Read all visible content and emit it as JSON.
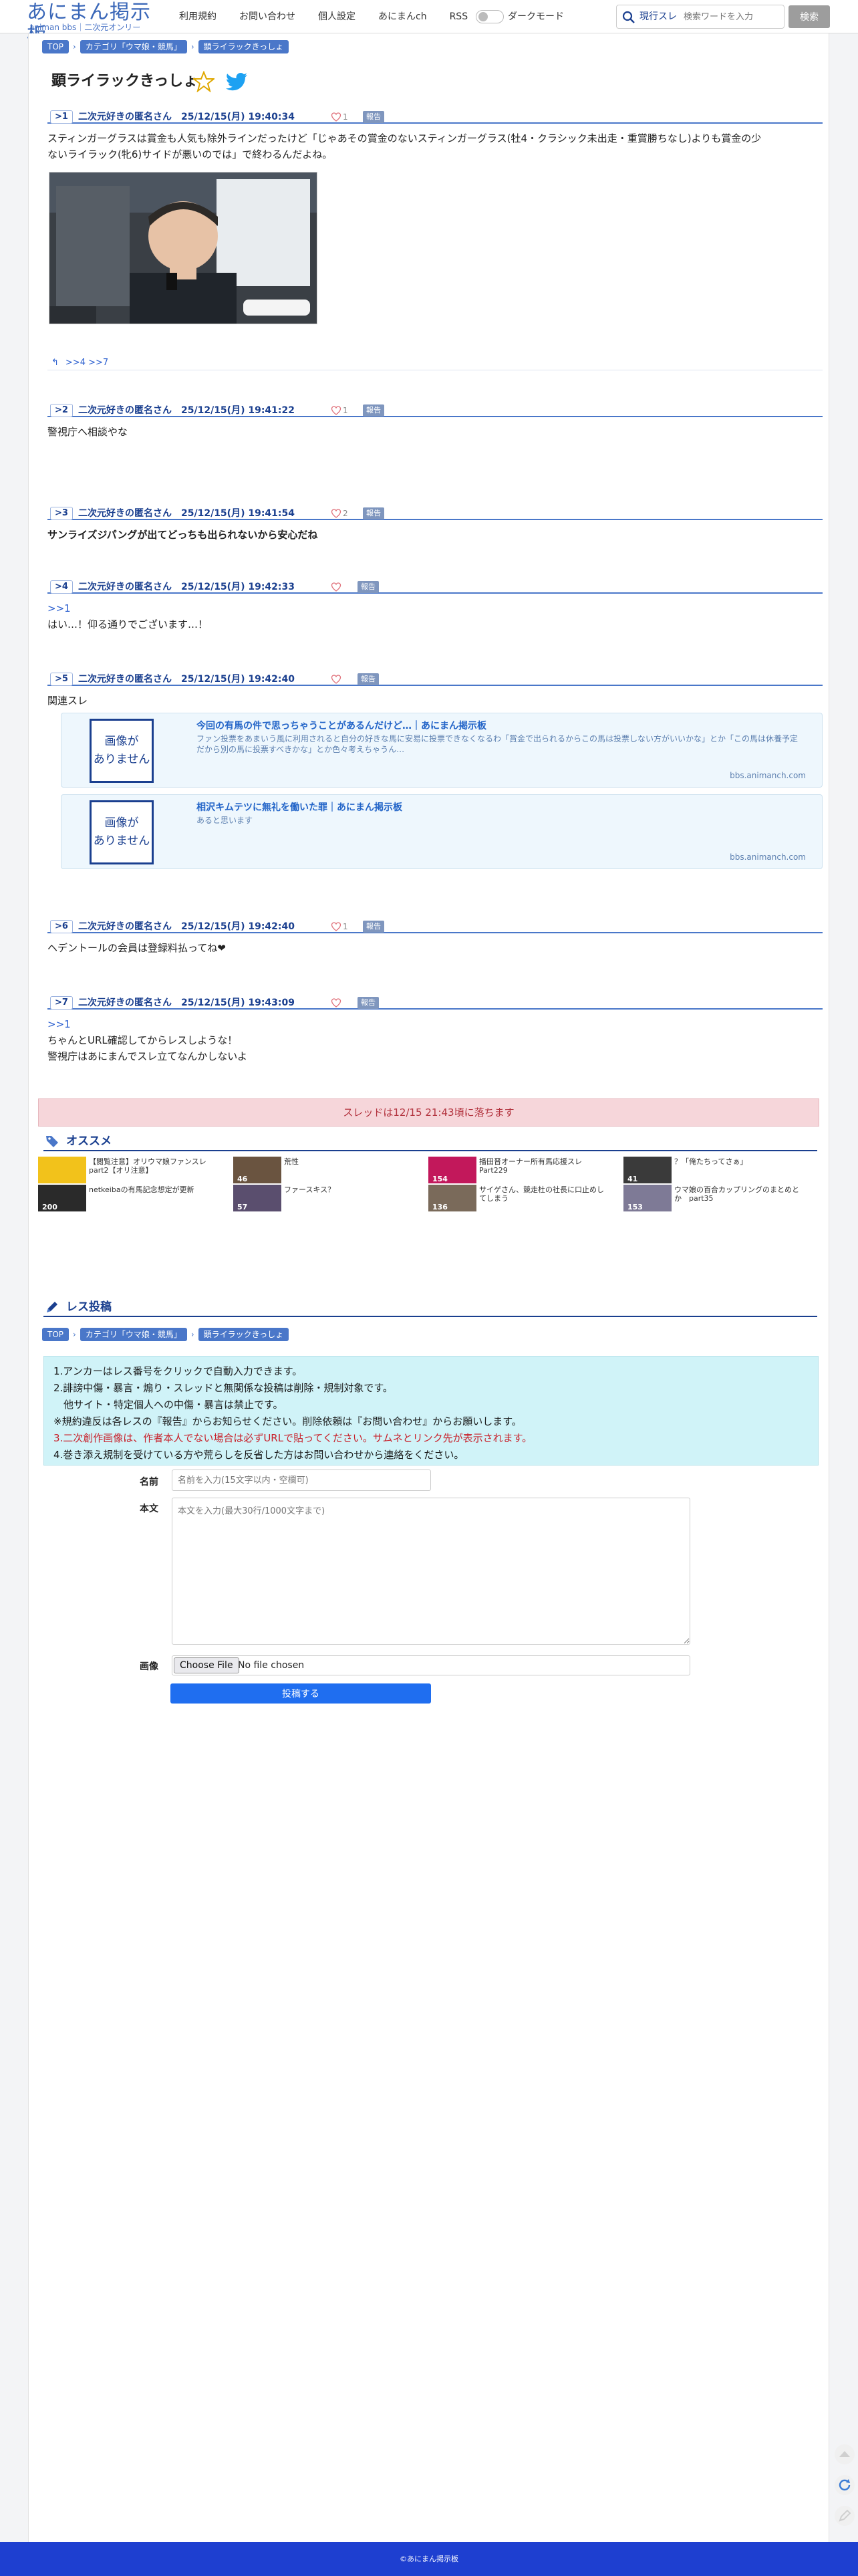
{
  "header": {
    "logo_main": "あにまん掲示板",
    "logo_sub": "animan bbs｜二次元オンリー",
    "menu": [
      "利用規約",
      "お問い合わせ",
      "個人設定",
      "あにまんch",
      "RSS"
    ],
    "dark_mode_label": "ダークモード",
    "search_scope": "現行スレ",
    "search_placeholder": "検索ワードを入力",
    "search_button": "検索"
  },
  "breadcrumb": [
    "TOP",
    "カテゴリ「ウマ娘・競馬」",
    "顕ライラックきっしょ"
  ],
  "thread": {
    "title": "顕ライラックきっしょ"
  },
  "posts": [
    {
      "num": "1",
      "meta": "二次元好きの匿名さん　25/12/15(月) 19:40:34",
      "likes": "1",
      "report": "報告",
      "lines": [
        "スティンガーグラスは賞金も人気も除外ラインだったけど「じゃあその賞金のないスティンガーグラス(牡4・クラシック未出走・重賞勝ちなし)よりも賞金の少",
        "ないライラック(牝6)サイドが悪いのでは」で終わるんだよね。"
      ],
      "replies": ">>4 >>7"
    },
    {
      "num": "2",
      "meta": "二次元好きの匿名さん　25/12/15(月) 19:41:22",
      "likes": "1",
      "report": "報告",
      "lines": [
        "警視庁へ相談やな"
      ]
    },
    {
      "num": "3",
      "meta": "二次元好きの匿名さん　25/12/15(月) 19:41:54",
      "likes": "2",
      "report": "報告",
      "lines": [
        "サンライズジパングが出てどっちも出られないから安心だね"
      ]
    },
    {
      "num": "4",
      "meta": "二次元好きの匿名さん　25/12/15(月) 19:42:33",
      "likes": "",
      "report": "報告",
      "anchor": ">>1",
      "lines": [
        "はい…！仰る通りでございます…！"
      ]
    },
    {
      "num": "5",
      "meta": "二次元好きの匿名さん　25/12/15(月) 19:42:40",
      "likes": "",
      "report": "報告",
      "lines": [
        "関連スレ"
      ],
      "cards": [
        {
          "noimg_1": "画像が",
          "noimg_2": "ありません",
          "title": "今回の有馬の件で思っちゃうことがあるんだけど…｜あにまん掲示板",
          "desc": "ファン投票をあまいう風に利用されると自分の好きな馬に安易に投票できなくなるわ「賞金で出られるからこの馬は投票しない方がいいかな」とか「この馬は休養予定だから別の馬に投票すべきかな」とか色々考えちゃうん…",
          "url": "bbs.animanch.com"
        },
        {
          "noimg_1": "画像が",
          "noimg_2": "ありません",
          "title": "相沢キムテツに無礼を働いた罪｜あにまん掲示板",
          "desc": "あると思います",
          "url": "bbs.animanch.com"
        }
      ]
    },
    {
      "num": "6",
      "meta": "二次元好きの匿名さん　25/12/15(月) 19:42:40",
      "likes": "1",
      "report": "報告",
      "lines": [
        "ヘデントールの会員は登録料払ってね❤"
      ]
    },
    {
      "num": "7",
      "meta": "二次元好きの匿名さん　25/12/15(月) 19:43:09",
      "likes": "",
      "report": "報告",
      "anchor": ">>1",
      "lines": [
        "ちゃんとURL確認してからレスしような！",
        "警視庁はあにまんでスレ立てなんかしないよ"
      ]
    }
  ],
  "drop_notice": "スレッドは12/15 21:43頃に落ちます",
  "recommend": {
    "heading": "オススメ",
    "items": [
      {
        "title": "【閲覧注意】オリウマ娘ファンスレ part2【オリ注意】",
        "count": "",
        "color": "#f2c21b"
      },
      {
        "title": "荒性",
        "count": "46",
        "color": "#6a5440"
      },
      {
        "title": "播田晋オーナー所有馬応援スレPart229",
        "count": "154",
        "color": "#c2185b"
      },
      {
        "title": "？「俺たちってさぁ」",
        "count": "41",
        "color": "#3a3a3a"
      },
      {
        "title": "netkeibaの有馬記念想定が更新",
        "count": "200",
        "color": "#2a2a2a"
      },
      {
        "title": "ファースキス？",
        "count": "57",
        "color": "#5a4e6e"
      },
      {
        "title": "サイゲさん、競走杜の社長に口止めしてしまう",
        "count": "136",
        "color": "#7a6a5a"
      },
      {
        "title": "ウマ娘の百合カップリングのまとめとか　part35",
        "count": "153",
        "color": "#7e7a96"
      }
    ]
  },
  "reply_form": {
    "heading": "レス投稿",
    "rules": [
      "1.アンカーはレス番号をクリックで自動入力できます。",
      "2.誹謗中傷・暴言・煽り・スレッドと無関係な投稿は削除・規制対象です。",
      "　他サイト・特定個人への中傷・暴言は禁止です。",
      "※規約違反は各レスの『報告』からお知らせください。削除依頼は『お問い合わせ』からお願いします。",
      "3.二次創作画像は、作者本人でない場合は必ずURLで貼ってください。サムネとリンク先が表示されます。",
      "4.巻き添え規制を受けている方や荒らしを反省した方はお問い合わせから連絡をください。"
    ],
    "name_label": "名前",
    "name_placeholder": "名前を入力(15文字以内・空欄可)",
    "body_label": "本文",
    "body_placeholder": "本文を入力(最大30行/1000文字まで)",
    "image_label": "画像",
    "file_button": "Choose File",
    "file_status": "No file chosen",
    "submit": "投稿する"
  },
  "footer": "©あにまん掲示板",
  "colors": {
    "accent": "#4a77c9",
    "link": "#2b5fcf",
    "footer": "#1e3fd0",
    "submit": "#1f6ef0"
  }
}
